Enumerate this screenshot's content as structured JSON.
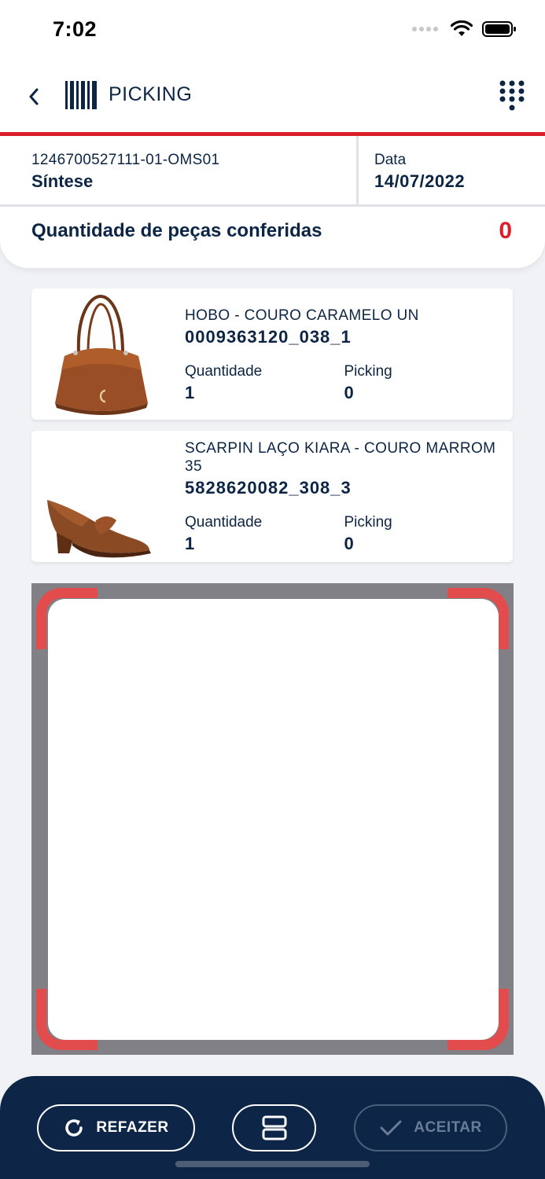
{
  "status_bar": {
    "time": "7:02"
  },
  "header": {
    "title": "PICKING"
  },
  "order": {
    "code": "1246700527111-01-OMS01",
    "name": "Síntese",
    "date_label": "Data",
    "date_value": "14/07/2022"
  },
  "summary": {
    "label": "Quantidade de peças conferidas",
    "value": "0"
  },
  "products": [
    {
      "name": "HOBO - COURO CARAMELO UN",
      "code": "0009363120_038_1",
      "quantity_label": "Quantidade",
      "quantity": "1",
      "picking_label": "Picking",
      "picking": "0",
      "icon": "handbag-image"
    },
    {
      "name": "SCARPIN LAÇO KIARA - COURO MARROM 35",
      "code": "5828620082_308_3",
      "quantity_label": "Quantidade",
      "quantity": "1",
      "picking_label": "Picking",
      "picking": "0",
      "icon": "shoe-image"
    }
  ],
  "actions": {
    "redo_label": "REFAZER",
    "accept_label": "ACEITAR"
  },
  "colors": {
    "primary": "#0d2647",
    "accent_red": "#d9202a",
    "scanner_corner": "#e24c4c",
    "background": "#f1f2f6"
  }
}
